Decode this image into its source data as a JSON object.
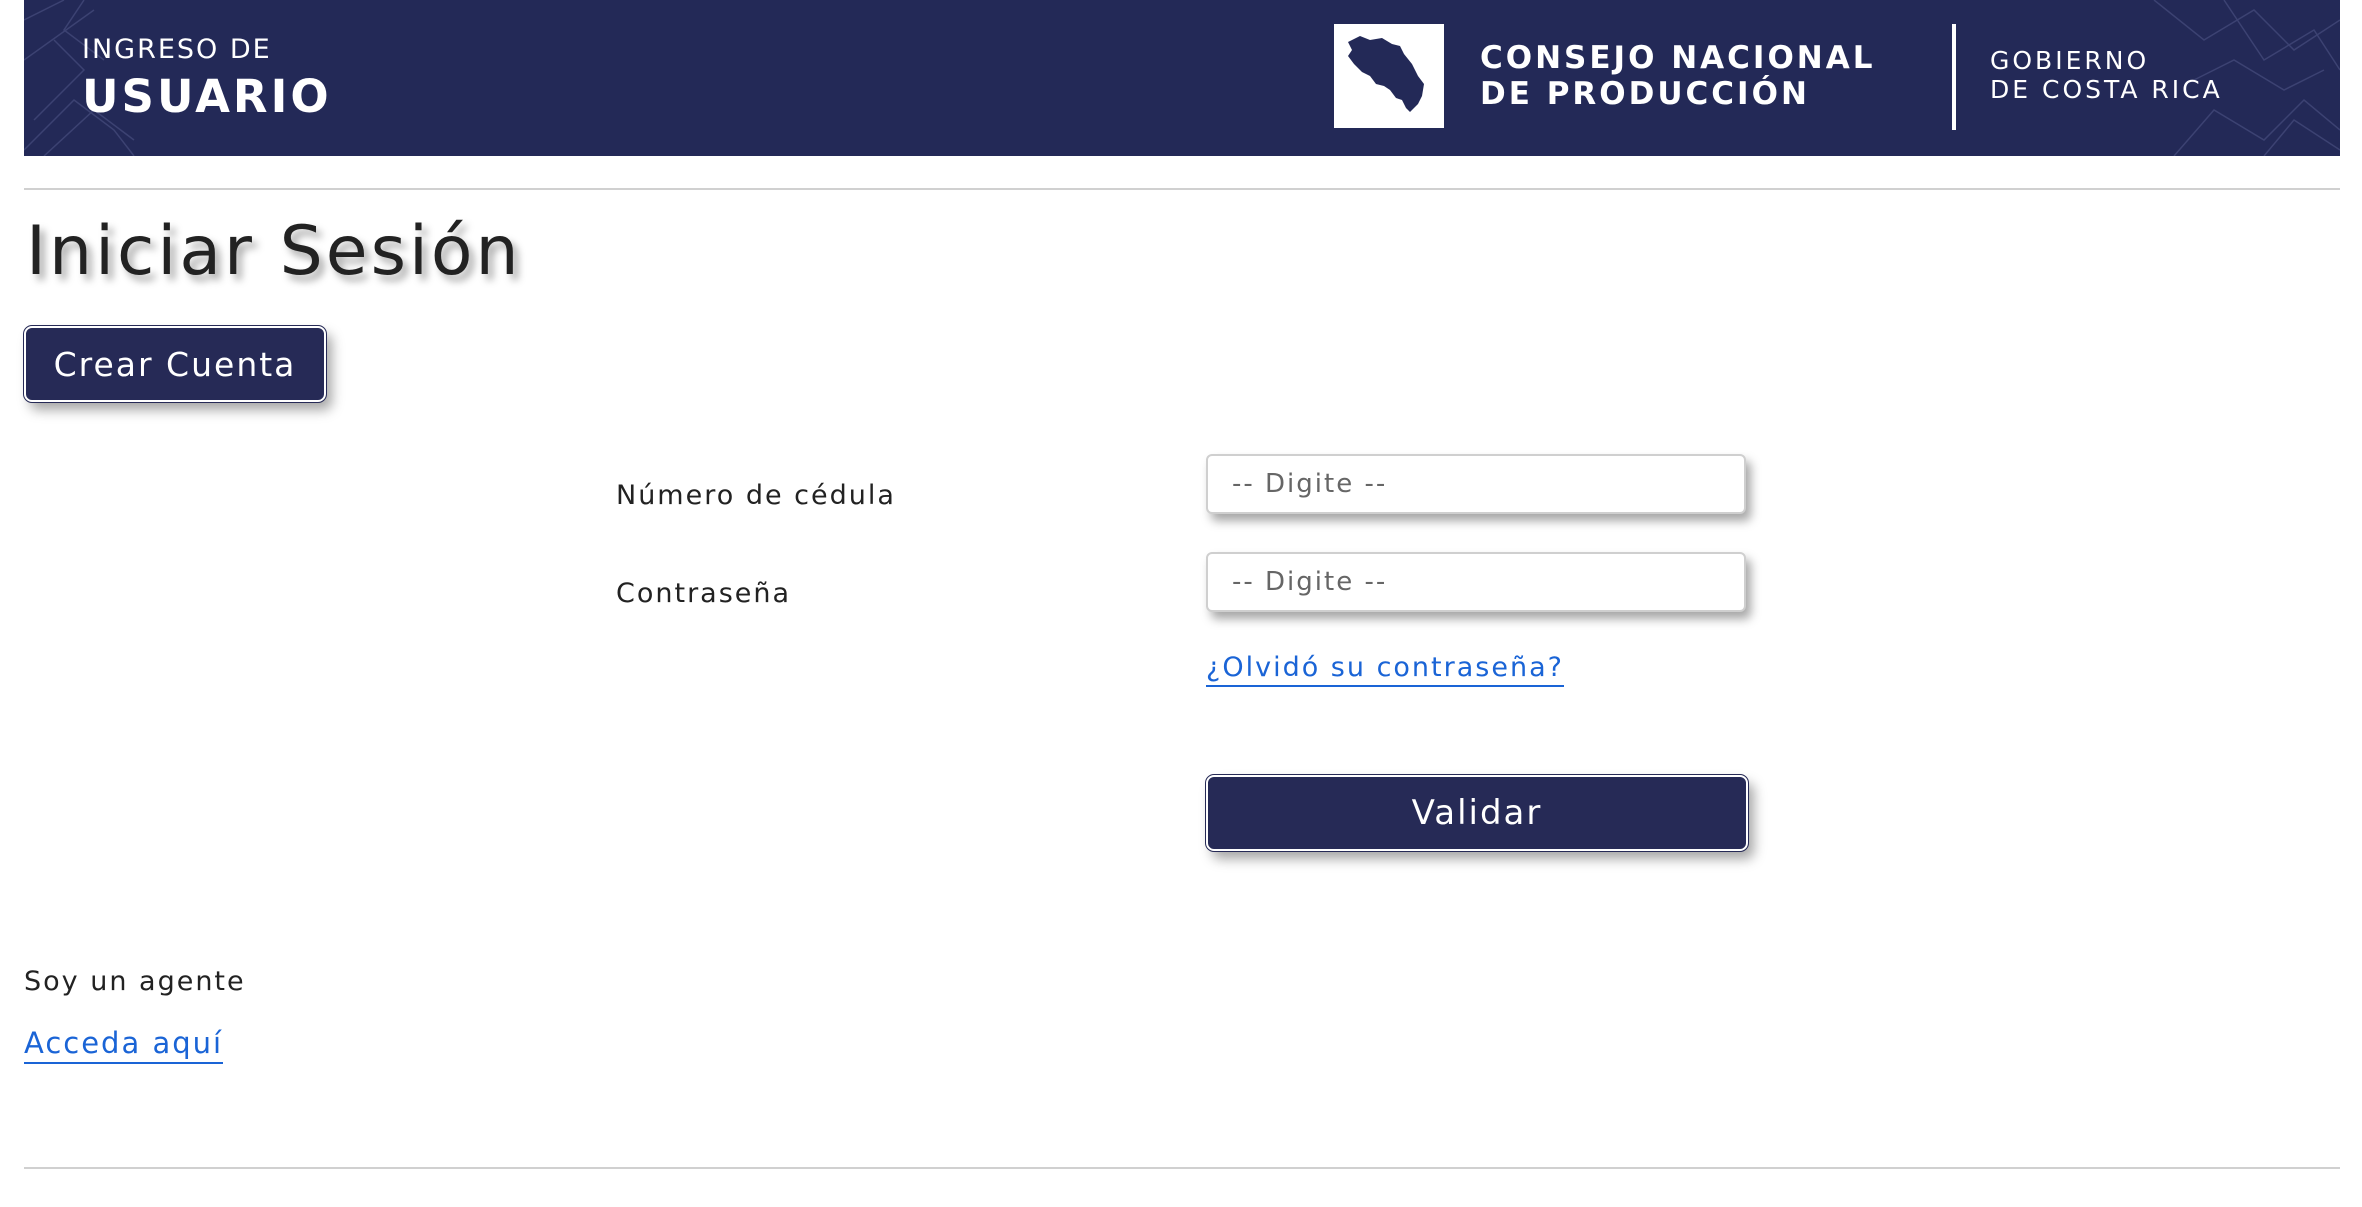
{
  "header": {
    "subtitle": "INGRESO DE",
    "title": "USUARIO",
    "org_line1": "CONSEJO NACIONAL",
    "org_line2": "DE PRODUCCIÓN",
    "gov_line1": "GOBIERNO",
    "gov_line2": "DE COSTA RICA",
    "logo_icon": "costa-rica-map-icon",
    "background_color": "#232957"
  },
  "page": {
    "title": "Iniciar Sesión",
    "create_account_label": "Crear Cuenta"
  },
  "form": {
    "cedula_label": "Número de cédula",
    "cedula_placeholder": "-- Digite --",
    "cedula_value": "",
    "password_label": "Contraseña",
    "password_placeholder": "-- Digite --",
    "password_value": "",
    "forgot_link": "¿Olvidó su contraseña?",
    "submit_label": "Validar"
  },
  "agent": {
    "text": "Soy un agente",
    "link": "Acceda aquí"
  },
  "colors": {
    "primary": "#262a56",
    "link": "#1a64d6"
  }
}
